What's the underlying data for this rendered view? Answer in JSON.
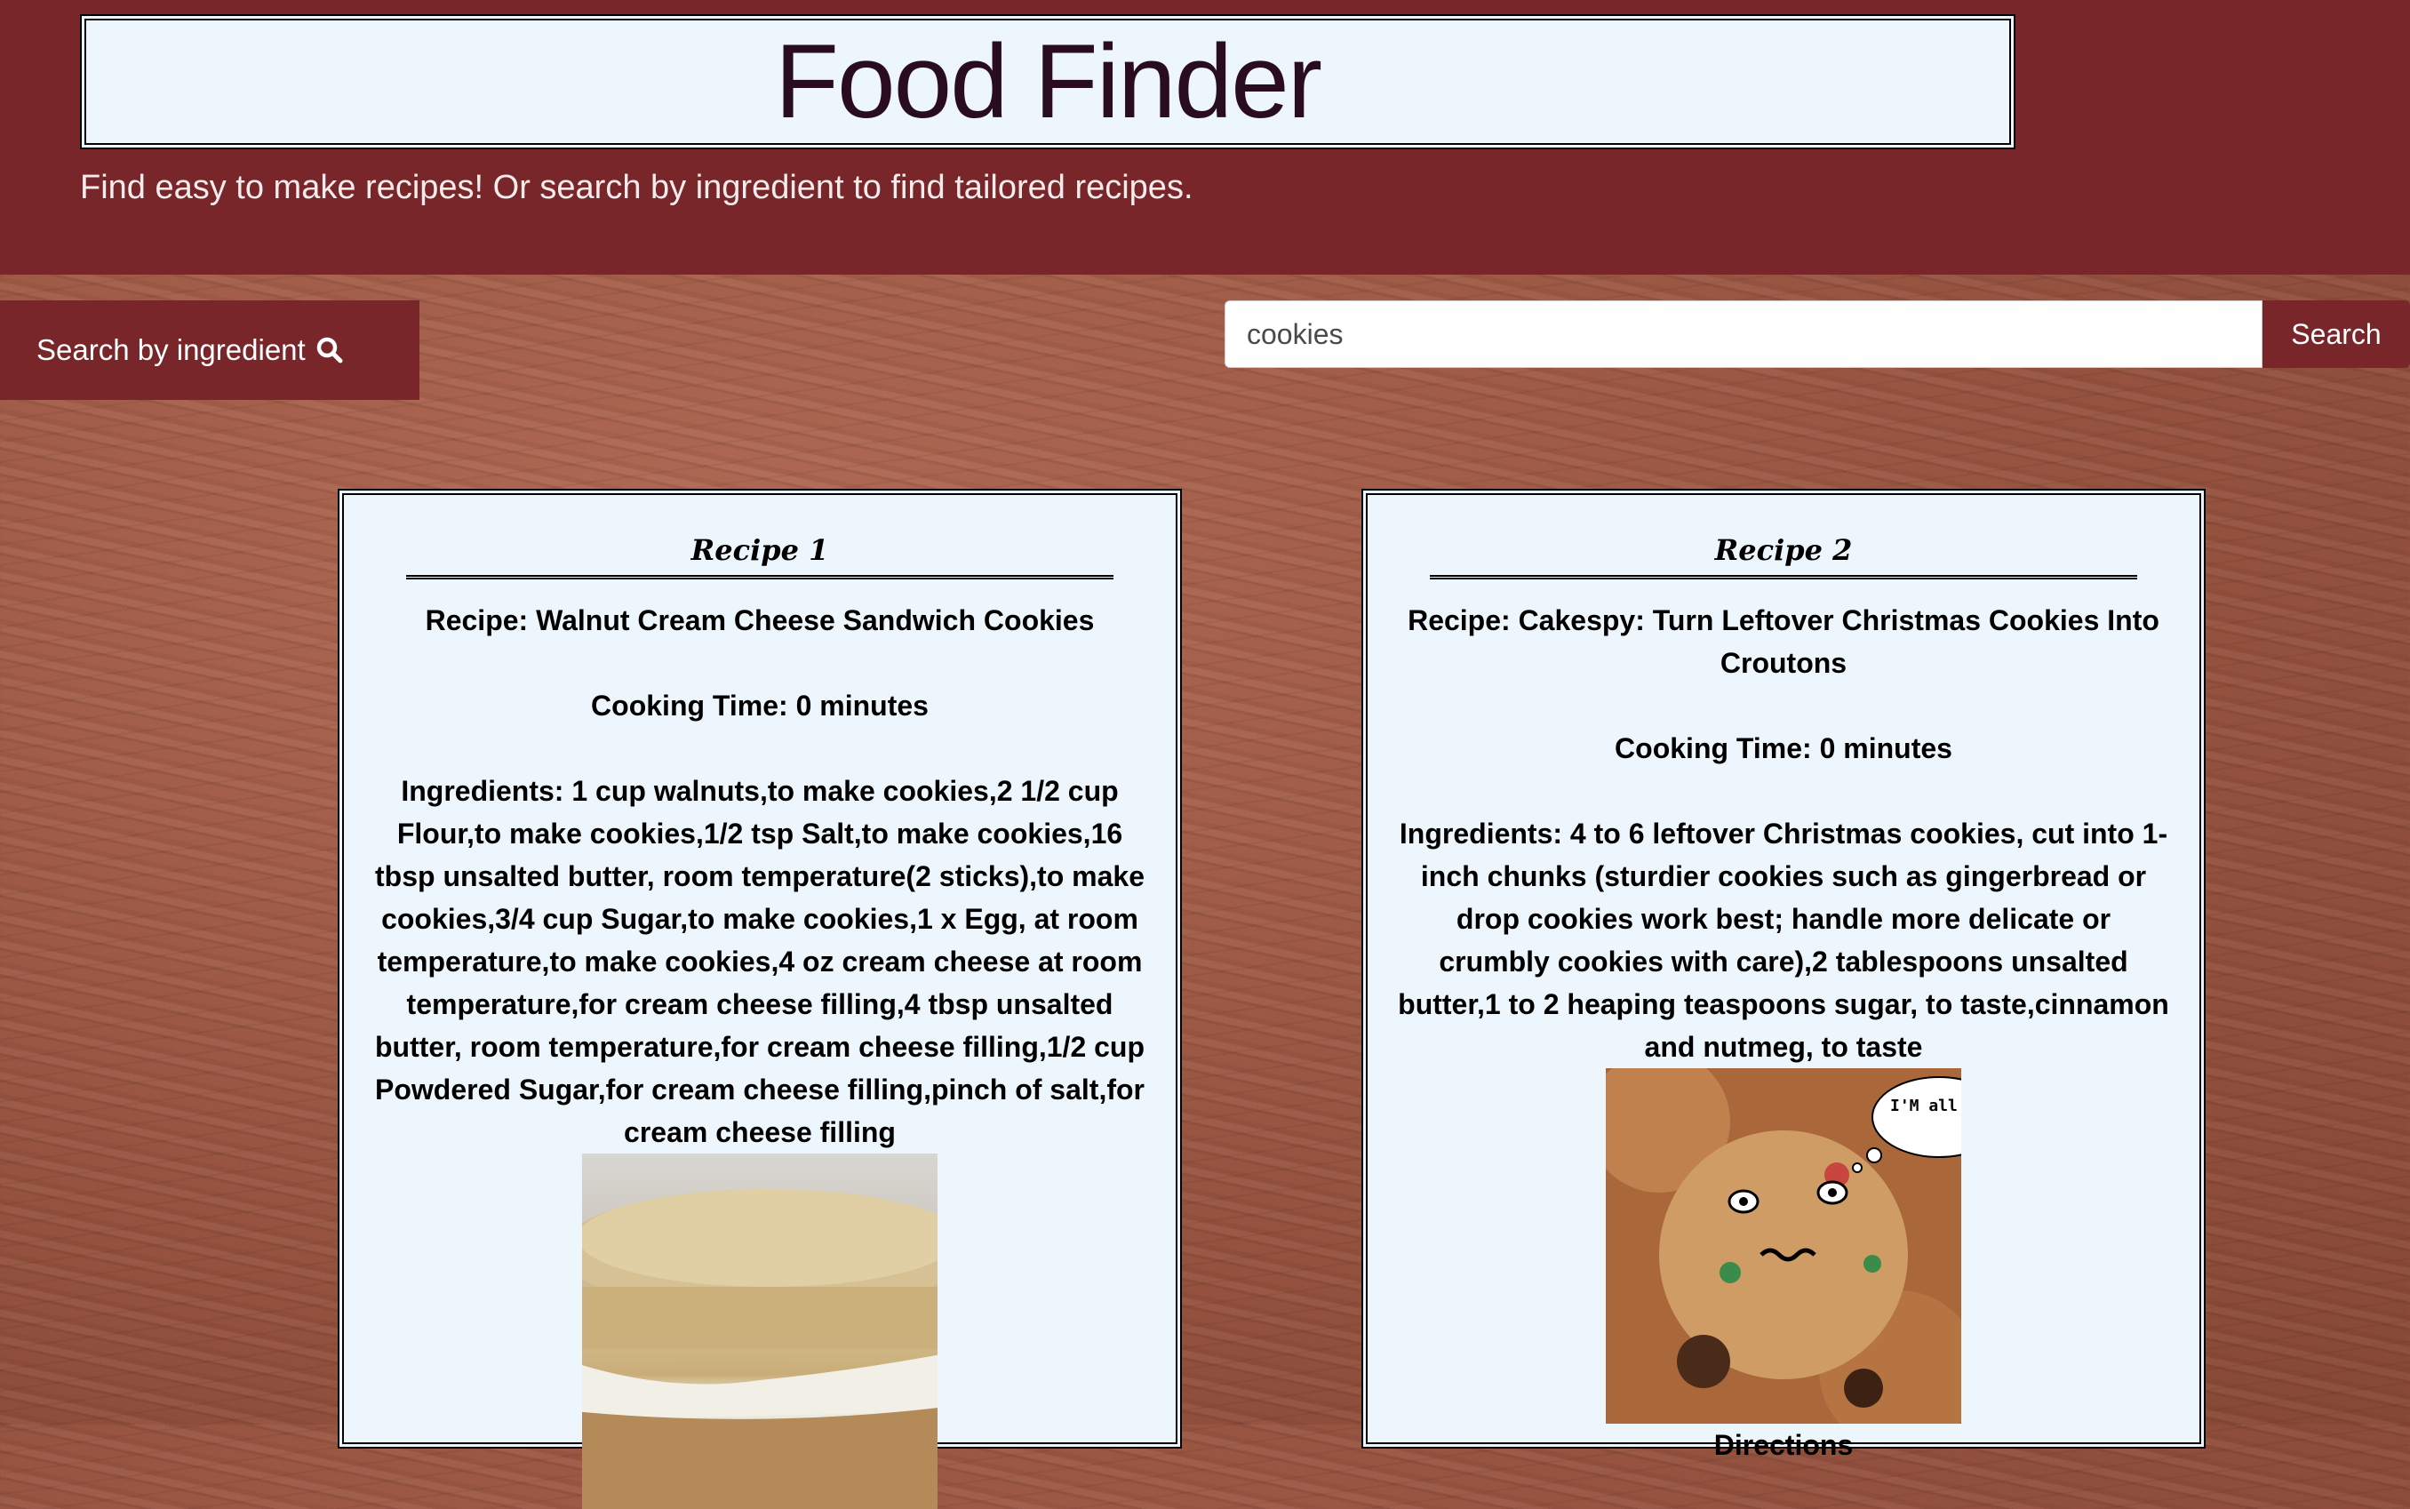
{
  "header": {
    "title": "Food Finder",
    "subtitle": "Find easy to make recipes! Or search by ingredient to find tailored recipes."
  },
  "controls": {
    "ingredient_button_label": "Search by ingredient",
    "ingredient_button_icon": "search-icon",
    "search_value": "cookies",
    "search_button_label": "Search"
  },
  "colors": {
    "brand": "#79262b",
    "card_bg": "#eef6fd",
    "title_text": "#2a0c20"
  },
  "recipes": [
    {
      "heading": "Recipe 1",
      "name": "Recipe: Walnut Cream Cheese Sandwich Cookies",
      "time": "Cooking Time: 0 minutes",
      "ingredients": "Ingredients: 1 cup walnuts,to make cookies,2 1/2 cup Flour,to make cookies,1/2 tsp Salt,to make cookies,16 tbsp unsalted butter, room temperature(2 sticks),to make cookies,3/4 cup Sugar,to make cookies,1 x Egg, at room temperature,to make cookies,4 oz cream cheese at room temperature,for cream cheese filling,4 tbsp unsalted butter, room temperature,for cream cheese filling,1/2 cup Powdered Sugar,for cream cheese filling,pinch of salt,for cream cheese filling"
    },
    {
      "heading": "Recipe 2",
      "name": "Recipe: Cakespy: Turn Leftover Christmas Cookies Into Croutons",
      "time": "Cooking Time: 0 minutes",
      "ingredients": "Ingredients: 4 to 6 leftover Christmas cookies, cut into 1-inch chunks (sturdier cookies such as gingerbread or drop cookies work best; handle more delicate or crumbly cookies with care),2 tablespoons unsalted butter,1 to 2 heaping teaspoons sugar, to taste,cinnamon and nutmeg, to taste",
      "image_caption": "I'M all DRIED O",
      "directions_label": "Directions"
    }
  ]
}
